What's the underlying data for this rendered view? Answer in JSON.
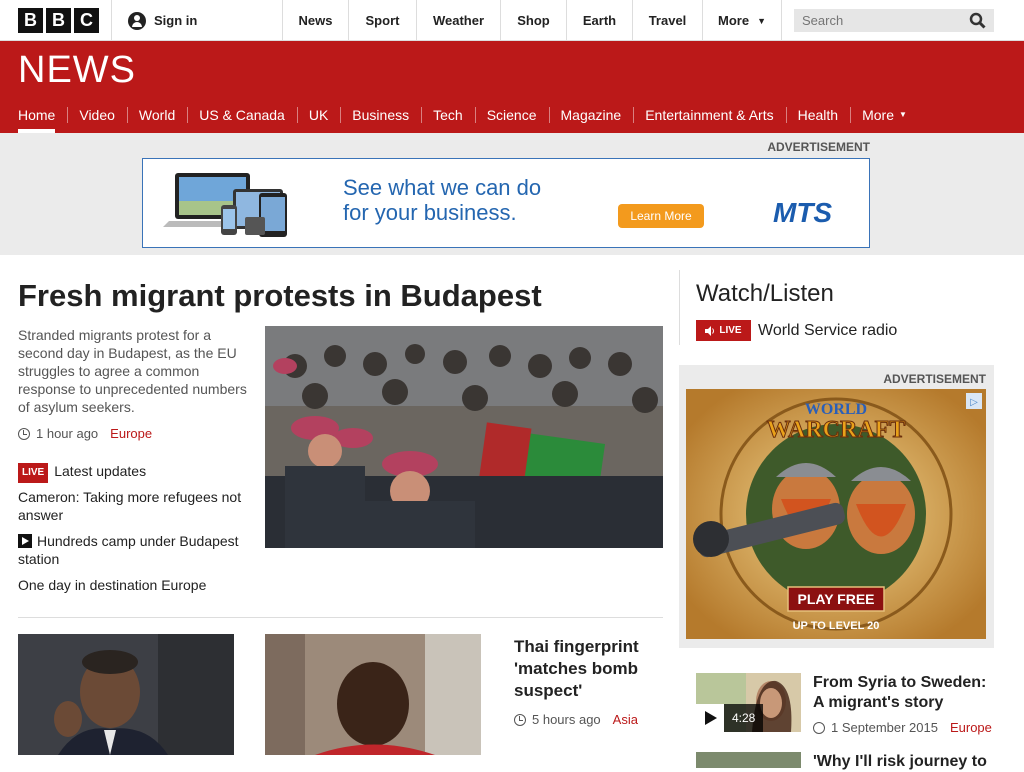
{
  "global_nav": {
    "logo_letters": [
      "B",
      "B",
      "C"
    ],
    "signin_label": "Sign in",
    "items": [
      "News",
      "Sport",
      "Weather",
      "Shop",
      "Earth",
      "Travel"
    ],
    "more_label": "More",
    "search_placeholder": "Search"
  },
  "news_header": {
    "title": "NEWS",
    "sections": [
      "Home",
      "Video",
      "World",
      "US & Canada",
      "UK",
      "Business",
      "Tech",
      "Science",
      "Magazine",
      "Entertainment & Arts",
      "Health"
    ],
    "more_label": "More",
    "active_section": "Home",
    "brand_color": "#bb1919"
  },
  "top_ad": {
    "label": "ADVERTISEMENT",
    "tagline_line1": "See what we can do",
    "tagline_line2": "for your business.",
    "cta": "Learn More",
    "brand": "MTS"
  },
  "lead_story": {
    "headline": "Fresh migrant protests in Budapest",
    "summary": "Stranded migrants protest for a second day in Budapest, as the EU struggles to agree a common response to unprecedented numbers of asylum seekers.",
    "time": "1 hour ago",
    "section": "Europe",
    "related": [
      {
        "badge": "LIVE",
        "text": "Latest updates"
      },
      {
        "text": "Cameron: Taking more refugees not answer"
      },
      {
        "icon": "video-play-icon",
        "text": "Hundreds camp under Budapest station"
      },
      {
        "text": "One day in destination Europe"
      }
    ]
  },
  "secondary_story": {
    "headline": "Thai fingerprint 'matches bomb suspect'",
    "time": "5 hours ago",
    "section": "Asia"
  },
  "watch_listen": {
    "title": "Watch/Listen",
    "live_badge": "LIVE",
    "live_item": "World Service radio"
  },
  "side_ad": {
    "label": "ADVERTISEMENT",
    "game_title_line1": "WORLD",
    "game_title_line2": "WARCRAFT",
    "cta": "PLAY FREE",
    "cta_sub": "UP TO LEVEL 20"
  },
  "side_stories": [
    {
      "title": "From Syria to Sweden: A migrant's story",
      "duration": "4:28",
      "date": "1 September 2015",
      "section": "Europe"
    },
    {
      "title": "'Why I'll risk journey to"
    }
  ]
}
